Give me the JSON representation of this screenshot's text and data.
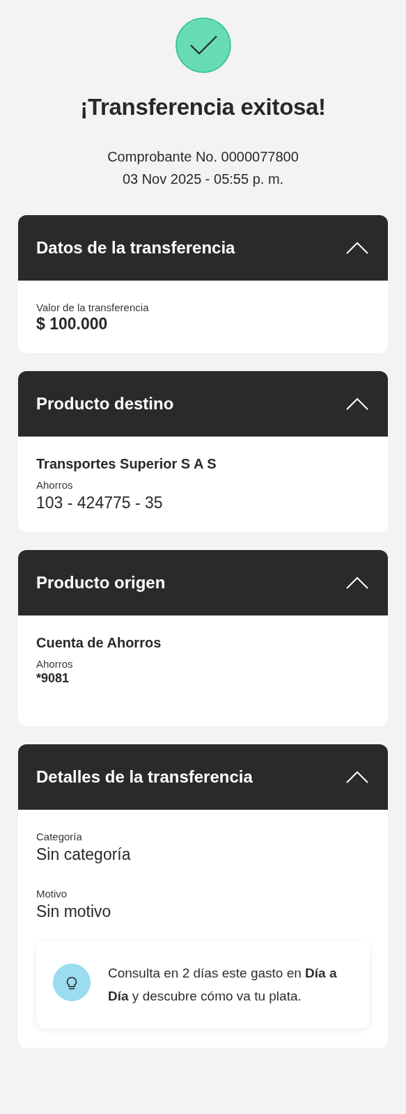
{
  "status": {
    "title": "¡Transferencia exitosa!",
    "receipt": "Comprobante No. 0000077800",
    "datetime": "03 Nov 2025 - 05:55 p. m."
  },
  "sections": [
    {
      "title": "Datos de la transferencia",
      "expanded": true,
      "fields": [
        {
          "kind": "label",
          "text": "Valor de la transferencia"
        },
        {
          "kind": "amount",
          "text": "$ 100.000"
        }
      ]
    },
    {
      "title": "Producto destino",
      "expanded": true,
      "fields": [
        {
          "kind": "title",
          "text": "Transportes Superior S A S"
        },
        {
          "kind": "label",
          "text": "Ahorros"
        },
        {
          "kind": "value",
          "text": "103 - 424775 - 35"
        }
      ]
    },
    {
      "title": "Producto origen",
      "expanded": true,
      "fields": [
        {
          "kind": "title",
          "text": "Cuenta de Ahorros"
        },
        {
          "kind": "label",
          "text": "Ahorros"
        },
        {
          "kind": "number",
          "text": "*9081"
        }
      ]
    },
    {
      "title": "Detalles de la transferencia",
      "expanded": true,
      "fields": [
        {
          "kind": "label",
          "text": "Categoría"
        },
        {
          "kind": "value",
          "text": "Sin categoría"
        },
        {
          "kind": "label",
          "text": "Motivo"
        },
        {
          "kind": "value",
          "text": "Sin motivo"
        }
      ],
      "tip": "Consulta en 2 días este gasto en **Día a Día** y descubre cómo va tu plata."
    }
  ]
}
